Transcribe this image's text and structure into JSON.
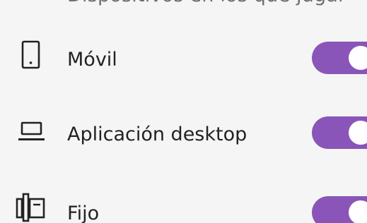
{
  "header": {
    "clipped_text": "Dispositivos en los que jugar"
  },
  "settings": {
    "items": [
      {
        "label": "Móvil",
        "icon": "phone-icon",
        "enabled": true
      },
      {
        "label": "Aplicación desktop",
        "icon": "laptop-icon",
        "enabled": true
      },
      {
        "label": "Fijo",
        "icon": "terminal-icon",
        "enabled": true
      }
    ]
  },
  "colors": {
    "background": "#f5f5f5",
    "toggle_on": "#8a55b8",
    "knob": "#ffffff",
    "label": "#222222"
  }
}
